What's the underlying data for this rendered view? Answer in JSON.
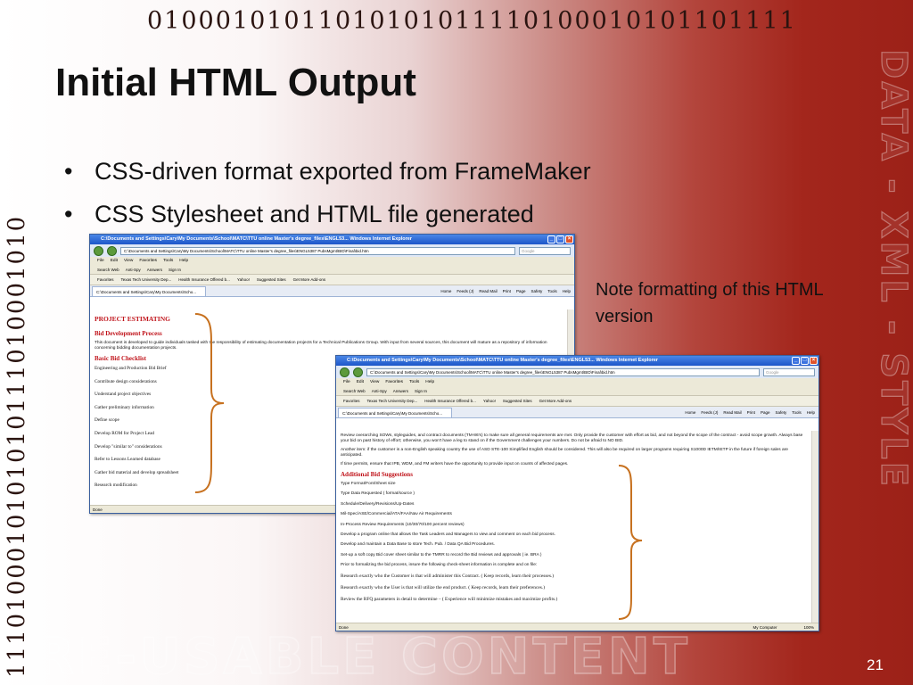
{
  "slide": {
    "title": "Initial HTML Output",
    "bullets": [
      "CSS-driven format exported from FrameMaker",
      "CSS Stylesheet and HTML file generated"
    ],
    "note": "Note formatting of this HTML version",
    "page_number": "21",
    "binary_top": "01000101011010101011110100010101101111",
    "binary_left": "1110100010101010111010001010",
    "watermark_bottom": "RE-USABLE CONTENT",
    "watermark_right": "DATA - XML - STYLE"
  },
  "browser1": {
    "title": "C:\\Documents and Settings\\Cary\\My Documents\\School\\MATC\\TTU online Master's degree_files\\ENGL53... Windows Internet Explorer",
    "address": "C:\\Documents and Settings\\Cary\\My Documents\\School\\MATC\\TTU online Master's degree_files\\ENGL5387 PubsMgmt\\BID\\Final\\bid.htm",
    "search_placeholder": "Google",
    "menu": [
      "File",
      "Edit",
      "View",
      "Favorites",
      "Tools",
      "Help"
    ],
    "toolbar": [
      "Search Web",
      "Anti-Spy",
      "Answers",
      "Sign In"
    ],
    "favorites": [
      "Favorites",
      "Texas Tech University Dep...",
      "Health Insurance Offered b...",
      "Yahoo!",
      "Suggested Sites",
      "Get More Add-ons"
    ],
    "tab": "C:\\Documents and Settings\\Cary\\My Documents\\Scho...",
    "commands": [
      "Home",
      "Feeds (J)",
      "Read Mail",
      "Print",
      "Page",
      "Safety",
      "Tools",
      "Help"
    ],
    "status": "Done",
    "content": {
      "heading": "PROJECT ESTIMATING",
      "subheading": "Bid Development Process",
      "intro": "This document is developed to guide individuals tasked with the responsibility of estimating documentation projects for a Technical Publications Group. With input from several sources, this document will mature as a repository of information concerning bidding documentation projects.",
      "checklist_title": "Basic Bid Checklist",
      "checklist": [
        "Engineering and Production Bid Brief",
        "Contribute design considerations",
        "Understand project objectives",
        "Gather preliminary information",
        "Define scope",
        "Develop ROM for Project Lead",
        "Develop \"similar to\" considerations",
        "Refer to Lessons Learned database",
        "Gather bid material and develop spreadsheet",
        "Research modification"
      ]
    }
  },
  "browser2": {
    "title": "C:\\Documents and Settings\\Cary\\My Documents\\School\\MATC\\TTU online Master's degree_files\\ENGL53... Windows Internet Explorer",
    "address": "C:\\Documents and Settings\\Cary\\My Documents\\School\\MATC\\TTU online Master's degree_files\\ENGL5387 PubsMgmt\\BID\\Final\\bid.htm",
    "search_placeholder": "Google",
    "menu": [
      "File",
      "Edit",
      "View",
      "Favorites",
      "Tools",
      "Help"
    ],
    "toolbar": [
      "Search Web",
      "Anti-Spy",
      "Answers",
      "Sign In"
    ],
    "favorites": [
      "Favorites",
      "Texas Tech University Dep...",
      "Health Insurance Offered b...",
      "Yahoo!",
      "Suggested Sites",
      "Get More Add-ons"
    ],
    "tab": "C:\\Documents and Settings\\Cary\\My Documents\\Scho...",
    "commands": [
      "Home",
      "Feeds (J)",
      "Read Mail",
      "Print",
      "Page",
      "Safety",
      "Tools",
      "Help"
    ],
    "status": "Done",
    "zone": "My Computer",
    "zoom": "100%",
    "content": {
      "para1": "Review overarching SOWs, styleguides, and contract documents (TM-86's) to make sure all general requirements are met. Only provide the customer with effort as bid, and not beyond the scope of the contract - avoid scope growth. Always base your bid on past history of effort; otherwise, you won't have a leg to stand on if the Government challenges your numbers. Do not be afraid to NO BID.",
      "para2": "Another item: if the customer is a non-English speaking country the use of ASD STE-100 Simplified English should be considered. This will also be required on larger programs requiring S1000D IETM/IETP in the future if foreign sales are anticipated.",
      "para3": "If time permits, ensure that IPB, WDM, and FM writers have the opportunity to provide input on counts of affected pages.",
      "suggestions_title": "Additional Bid Suggestions",
      "suggestions": [
        "Type Format/Font/Sheet size",
        "Type Data Requested ( format/source )",
        "Schedule/Delivery/Revisions/Up-Dates",
        "Mil-Spec/ASE/Commercial/ATA/FAA/Nav Air Requirements",
        "In-Process Review Requirements (10/30/70/100 percent reviews)",
        "Develop a program online that allows the Task Leaders and Managers to view and comment on each bid process.",
        "Develop and maintain a Data Base to store Tech. Pub. / Data QA Bid Procedures.",
        "Set-up a soft copy Bid cover sheet similar to the TMRR to record the Bid reviews and approvals ( ie. BRA )",
        "Prior to formalizing the bid process, insure the following check-sheet information is complete and on file:"
      ],
      "research": [
        "Research exactly who the Customer is that will administer this Contract. ( Keep records, learn their processes.)",
        "Research exactly who the User is that will utilize the end product. ( Keep records, learn their preferences.)",
        "Review the RFQ parameters in detail to determine – ( Experience will minimize mistakes and maximize profits.)"
      ]
    }
  },
  "colors": {
    "accent_red": "#c0141b",
    "slide_red": "#a3261c",
    "brace_orange": "#c7711f"
  }
}
